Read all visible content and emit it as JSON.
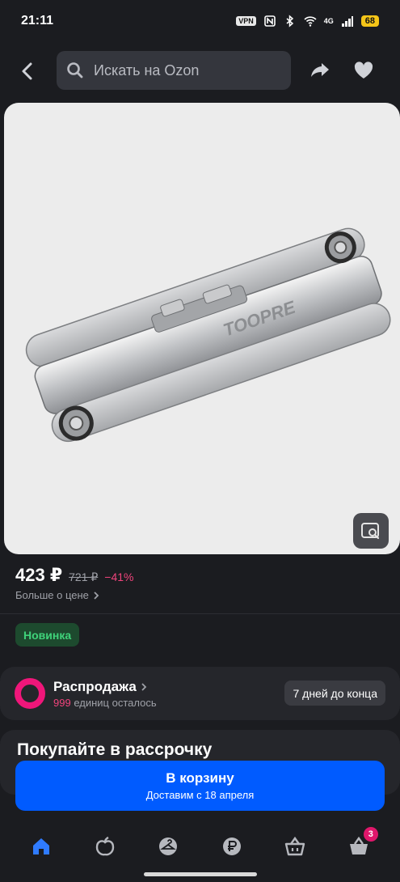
{
  "status_bar": {
    "time": "21:11",
    "vpn": "VPN",
    "network": "4G",
    "battery": "68"
  },
  "header": {
    "search_placeholder": "Искать на Ozon",
    "icons": [
      "back-arrow-icon",
      "search-icon",
      "share-icon",
      "heart-icon"
    ]
  },
  "product": {
    "brand_on_image": "TOOPRE",
    "price": "423 ₽",
    "old_price": "721 ₽",
    "discount": "−41%",
    "more_price_link": "Больше о цене",
    "badge": "Новинка"
  },
  "sale": {
    "title": "Распродажа",
    "count": "999",
    "count_suffix": "единиц осталось",
    "deadline": "7 дней до конца"
  },
  "installment": {
    "title": "Покупайте в рассрочку"
  },
  "cart_button": {
    "label": "В корзину",
    "delivery": "Доставим с 18 апреля"
  },
  "bottom_nav": {
    "items": [
      "home-icon",
      "fresh-icon",
      "fashion-icon",
      "ruble-icon",
      "basket-icon",
      "cart-icon"
    ],
    "cart_badge": "3"
  },
  "colors": {
    "background": "#1b1c20",
    "accent": "#005bff",
    "discount": "#f0447c",
    "new_badge": "#3fd37a",
    "sale_brand": "#f0167a"
  }
}
